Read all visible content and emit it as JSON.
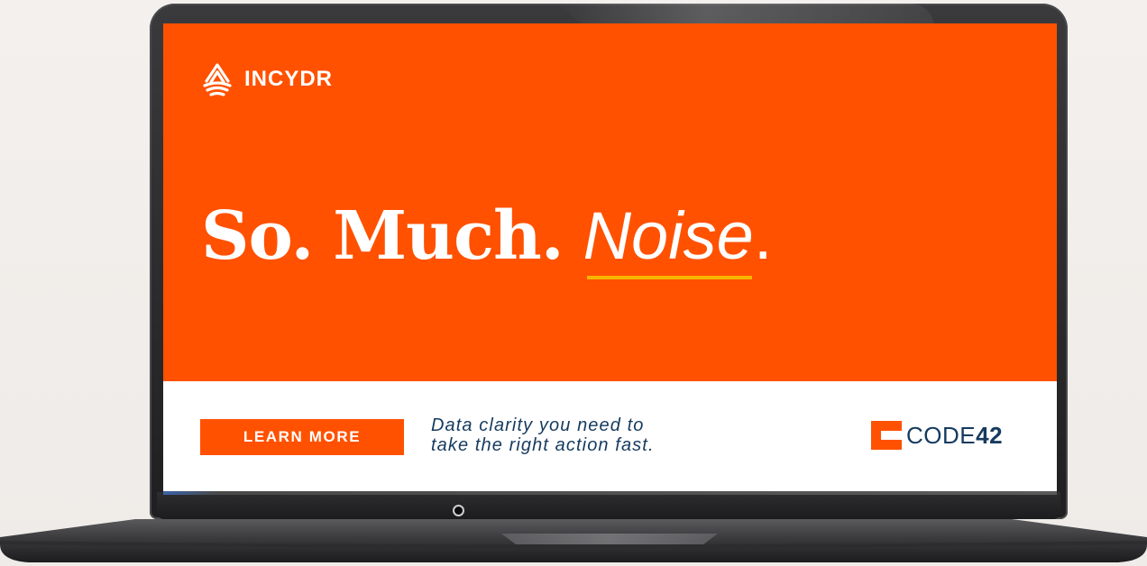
{
  "brand": {
    "name": "INCYDR",
    "color": "#ffffff"
  },
  "headline": {
    "part1": "So.",
    "part2": "Much.",
    "part3": "Noise",
    "part3_punct": ".",
    "underline_color": "#f7b500"
  },
  "cta": {
    "label": "LEARN MORE"
  },
  "tagline": {
    "line1": "Data clarity you need to",
    "line2": "take the right action fast."
  },
  "company": {
    "name_prefix": "CODE",
    "name_number": "42"
  },
  "colors": {
    "accent_orange": "#ff5100",
    "navy": "#163a5f",
    "background": "#f1eeeb",
    "laptop_body": "#2a2a2c"
  },
  "icons": {
    "brand_logo": "incydr-logo-icon",
    "company_logo": "code42-logo-icon",
    "camera": "webcam-icon"
  }
}
